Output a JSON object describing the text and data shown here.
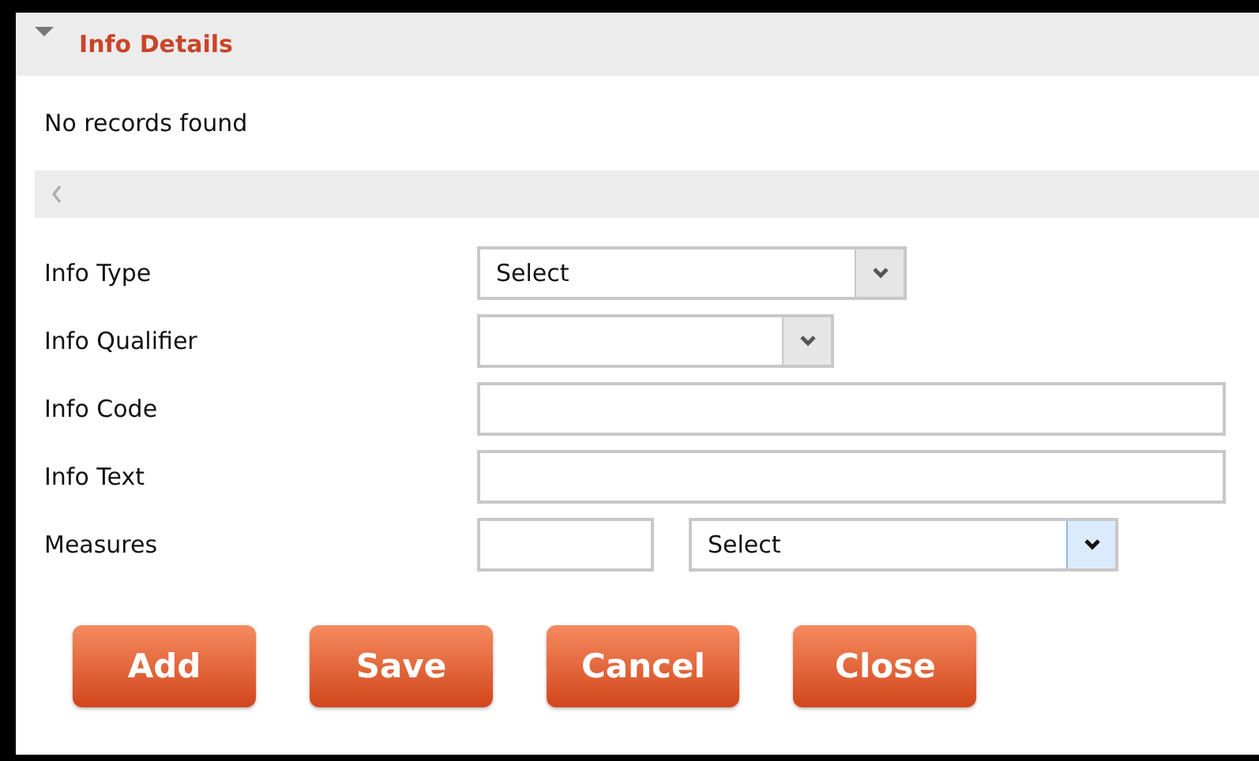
{
  "panel": {
    "title": "Info Details",
    "expanded": true
  },
  "empty_message": "No records found",
  "fields": [
    {
      "label": "Info Type",
      "controls": [
        {
          "kind": "select",
          "value": "Select",
          "highlighted": false
        }
      ]
    },
    {
      "label": "Info Qualifier",
      "controls": [
        {
          "kind": "select",
          "highlighted": false
        }
      ]
    },
    {
      "label": "Info Code",
      "controls": [
        {
          "kind": "text"
        }
      ]
    },
    {
      "label": "Info Text",
      "controls": [
        {
          "kind": "text"
        }
      ]
    },
    {
      "label": "Measures",
      "controls": [
        {
          "kind": "text"
        },
        {
          "kind": "select",
          "value": "Select",
          "highlighted": true
        }
      ]
    }
  ],
  "buttons": [
    "Add",
    "Save",
    "Cancel",
    "Close"
  ]
}
